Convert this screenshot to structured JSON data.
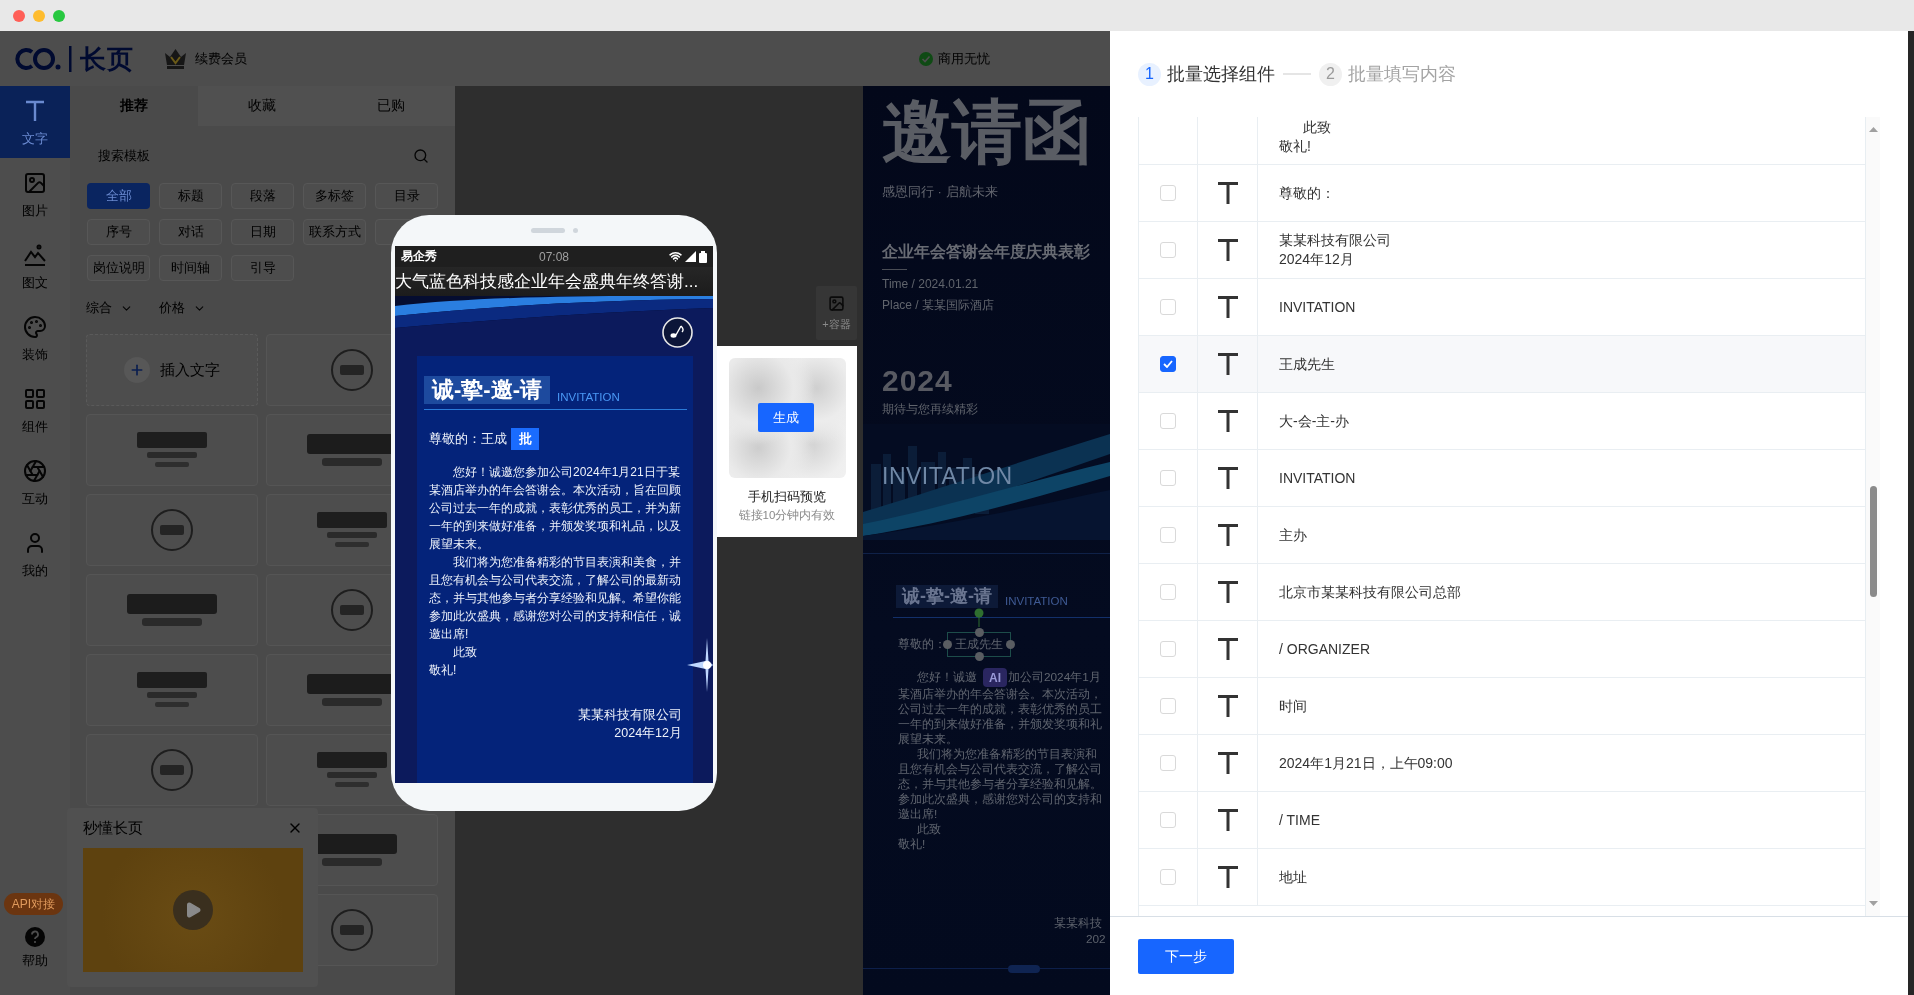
{
  "header": {
    "brand": "长页",
    "renew": "续费会员",
    "commercial": "商用无忧"
  },
  "rail": {
    "items": [
      {
        "kind": "text",
        "label": "文字",
        "selected": true
      },
      {
        "kind": "image",
        "label": "图片",
        "selected": false
      },
      {
        "kind": "graphic",
        "label": "图文",
        "selected": false
      },
      {
        "kind": "decor",
        "label": "装饰",
        "selected": false
      },
      {
        "kind": "component",
        "label": "组件",
        "selected": false
      },
      {
        "kind": "interact",
        "label": "互动",
        "selected": false
      },
      {
        "kind": "profile",
        "label": "我的",
        "selected": false
      }
    ],
    "api_badge": "API对接",
    "help": "帮助"
  },
  "library": {
    "tabs": [
      {
        "label": "推荐",
        "selected": true
      },
      {
        "label": "收藏",
        "selected": false
      },
      {
        "label": "已购",
        "selected": false
      }
    ],
    "search": {
      "placeholder": "搜索模板"
    },
    "chips": [
      {
        "label": "全部",
        "selected": true
      },
      {
        "label": "标题",
        "selected": false
      },
      {
        "label": "段落",
        "selected": false
      },
      {
        "label": "多标签",
        "selected": false
      },
      {
        "label": "目录",
        "selected": false
      },
      {
        "label": "序号",
        "selected": false
      },
      {
        "label": "对话",
        "selected": false
      },
      {
        "label": "日期",
        "selected": false
      },
      {
        "label": "联系方式",
        "selected": false
      },
      {
        "selected": false
      },
      {
        "label": "岗位说明",
        "selected": false
      },
      {
        "label": "时间轴",
        "selected": false
      },
      {
        "label": "引导",
        "selected": false
      }
    ],
    "sorts": [
      "综合",
      "价格"
    ],
    "cards": [
      {
        "kind": "insert",
        "label": "插入文字"
      },
      {
        "kind": "template"
      },
      {
        "kind": "template"
      },
      {
        "kind": "template"
      },
      {
        "kind": "template"
      },
      {
        "kind": "template"
      },
      {
        "kind": "template"
      },
      {
        "kind": "template"
      },
      {
        "kind": "template"
      },
      {
        "kind": "template"
      },
      {
        "kind": "template"
      },
      {
        "kind": "template"
      },
      {
        "kind": "template"
      },
      {
        "kind": "template"
      }
    ]
  },
  "intro_popup": {
    "title": "秒懂长页"
  },
  "phone": {
    "app_name": "易企秀",
    "time": "07:08",
    "title": "大气蓝色科技感企业年会盛典年终答谢...",
    "heading": "诚-挚-邀-请",
    "heading_en": "INVITATION",
    "salutation": "尊敬的：",
    "recipient": "王成",
    "batch_badge": "批",
    "paragraphs": [
      {
        "text": "您好！诚邀您参加公司2024年1月21日于某某酒店举办的年会答谢会。本次活动，旨在回顾公司过去一年的成就，表彰优秀的员工，并为新一年的到来做好准备，并颁发奖项和礼品，以及展望未来。",
        "indent": true
      },
      {
        "text": "我们将为您准备精彩的节目表演和美食，并且您有机会与公司代表交流，了解公司的最新动态，并与其他参与者分享经验和见解。希望你能参加此次盛典，感谢您对公司的支持和信任，诚邀出席!",
        "indent": true
      },
      {
        "text": "此致",
        "indent": true
      },
      {
        "text": "敬礼!",
        "indent": false
      }
    ],
    "signature": [
      "某某科技有限公司",
      "2024年12月"
    ]
  },
  "qr_preview": {
    "action": "生成",
    "title": "手机扫码预览",
    "note": "链接10分钟内有效"
  },
  "container_tool": {
    "label": "+容器"
  },
  "canvas": {
    "title": "邀请函",
    "slogan": "感恩同行 · 启航未来",
    "event": "企业年会答谢会年度庆典表彰",
    "time": "Time / 2024.01.21",
    "place": "Place / 某某国际酒店",
    "year": "2024",
    "tagline": "期待与您再续精彩",
    "banner_text": "INVITATION",
    "heading": "诚-挚-邀-请",
    "heading_en": "INVITATION",
    "salutation": "尊敬的：",
    "selected_text": "王成先生",
    "first_line": {
      "before": "您好！诚邀",
      "after": "加公司2024年1月"
    },
    "ai_badge": "AI",
    "body_lines": [
      {
        "text": "某酒店举办的年会答谢会。本次活动，",
        "indent": false
      },
      {
        "text": "公司过去一年的成就，表彰优秀的员工",
        "indent": false
      },
      {
        "text": "一年的到来做好准备，并颁发奖项和礼",
        "indent": false
      },
      {
        "text": "展望未来。",
        "indent": false
      },
      {
        "text": "我们将为您准备精彩的节目表演和",
        "indent": true
      },
      {
        "text": "且您有机会与公司代表交流，了解公司",
        "indent": false
      },
      {
        "text": "态，并与其他参与者分享经验和见解。",
        "indent": false
      },
      {
        "text": "参加此次盛典，感谢您对公司的支持和",
        "indent": false
      },
      {
        "text": "邀出席!",
        "indent": false
      },
      {
        "text": "此致",
        "indent": true
      },
      {
        "text": "敬礼!",
        "indent": false
      }
    ],
    "signature": [
      "某某科技",
      "202"
    ]
  },
  "drawer": {
    "steps": [
      {
        "number": "1",
        "label": "批量选择组件",
        "selected": true
      },
      {
        "number": "2",
        "label": "批量填写内容",
        "selected": false
      }
    ],
    "clipped_lines": [
      {
        "text": "此致",
        "indent": true
      },
      {
        "text": "敬礼!",
        "indent": false
      }
    ],
    "rows": [
      {
        "checked": false,
        "lines": [
          "尊敬的："
        ]
      },
      {
        "checked": false,
        "lines": [
          "某某科技有限公司",
          "2024年12月"
        ]
      },
      {
        "checked": false,
        "lines": [
          "INVITATION"
        ]
      },
      {
        "checked": true,
        "lines": [
          "王成先生"
        ]
      },
      {
        "checked": false,
        "lines": [
          "大-会-主-办"
        ]
      },
      {
        "checked": false,
        "lines": [
          "INVITATION"
        ]
      },
      {
        "checked": false,
        "lines": [
          "主办"
        ]
      },
      {
        "checked": false,
        "lines": [
          "北京市某某科技有限公司总部"
        ]
      },
      {
        "checked": false,
        "lines": [
          "/ ORGANIZER"
        ]
      },
      {
        "checked": false,
        "lines": [
          "时间"
        ]
      },
      {
        "checked": false,
        "lines": [
          "2024年1月21日，上午09:00"
        ]
      },
      {
        "checked": false,
        "lines": [
          "/ TIME"
        ]
      },
      {
        "checked": false,
        "lines": [
          "地址"
        ]
      }
    ],
    "next": "下一步"
  }
}
